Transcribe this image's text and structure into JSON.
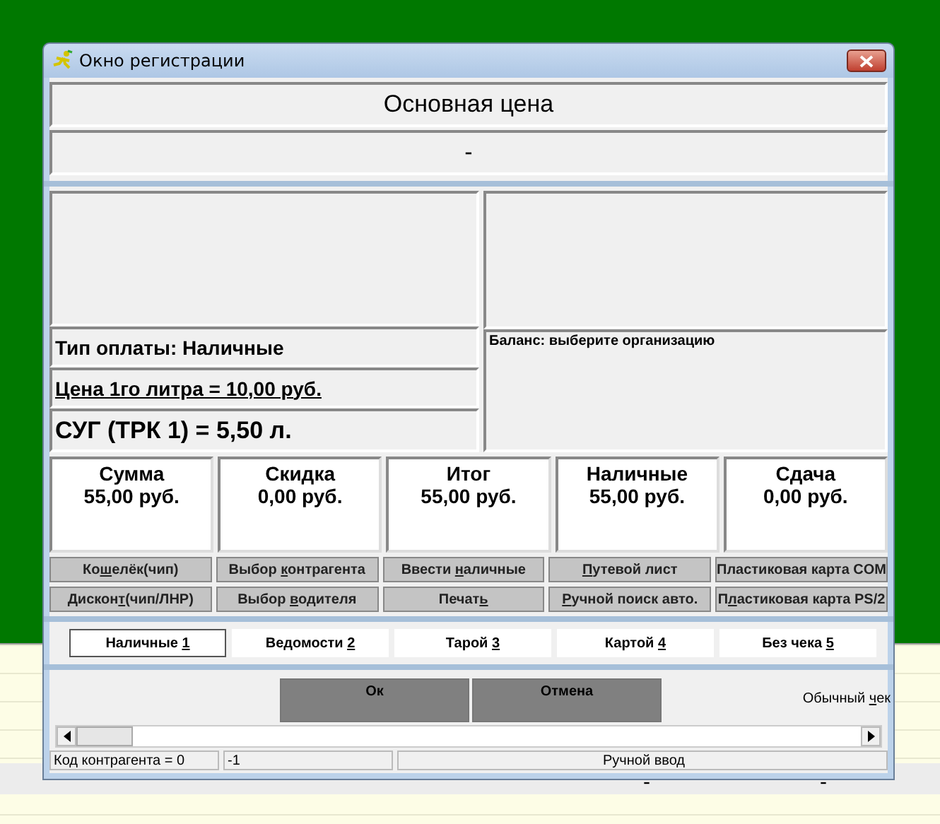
{
  "background_table": {
    "rows": [
      {
        "cells": [
          "-",
          "-"
        ]
      }
    ]
  },
  "window": {
    "title": "Окно регистрации"
  },
  "header": {
    "price_type": "Основная цена",
    "subtitle": "-"
  },
  "info": {
    "payment_type": "Тип оплаты:  Наличные",
    "price_per_liter": "Цена 1го литра = 10,00   руб.",
    "fuel": "СУГ (ТРК 1) = 5,50 л.",
    "balance": "Баланс: выберите организацию"
  },
  "totals": [
    {
      "label": "Сумма",
      "value": "55,00  руб."
    },
    {
      "label": "Скидка",
      "value": "0,00  руб."
    },
    {
      "label": "Итог",
      "value": "55,00  руб."
    },
    {
      "label": "Наличные",
      "value": "55,00  руб."
    },
    {
      "label": "Сдача",
      "value": "0,00  руб."
    }
  ],
  "actions": [
    {
      "text": "Ко",
      "hotkey": "ш",
      "rest": "елёк(чип)"
    },
    {
      "text": "Выбор ",
      "hotkey": "к",
      "rest": "онтрагента"
    },
    {
      "text": "Ввести ",
      "hotkey": "н",
      "rest": "аличные"
    },
    {
      "hotkey": "П",
      "rest": "утевой лист"
    },
    {
      "text": "Пластиковая карта COM"
    },
    {
      "text": "Дискон",
      "hotkey": "т",
      "rest": "(чип/ЛНР)"
    },
    {
      "text": "Выбор ",
      "hotkey": "в",
      "rest": "одителя"
    },
    {
      "text": "Печат",
      "hotkey": "ь"
    },
    {
      "hotkey": "Р",
      "rest": "учной поиск авто."
    },
    {
      "text": "П",
      "hotkey": "л",
      "rest": "астиковая карта PS/2"
    }
  ],
  "payment_tabs": [
    {
      "text": "Наличные ",
      "hotkey": "1",
      "selected": true
    },
    {
      "text": "Ведомости ",
      "hotkey": "2",
      "selected": false
    },
    {
      "text": "Тарой ",
      "hotkey": "3",
      "selected": false
    },
    {
      "text": "Картой ",
      "hotkey": "4",
      "selected": false
    },
    {
      "text": "Без чека ",
      "hotkey": "5",
      "selected": false
    }
  ],
  "buttons": [
    {
      "label": "Ок"
    },
    {
      "label": "Отмена"
    }
  ],
  "receipt_mode": {
    "text": "Обычный ",
    "hotkey": "ч",
    "rest": "ек"
  },
  "status_bar": [
    "Код контрагента = 0",
    "-1",
    "Ручной ввод"
  ]
}
